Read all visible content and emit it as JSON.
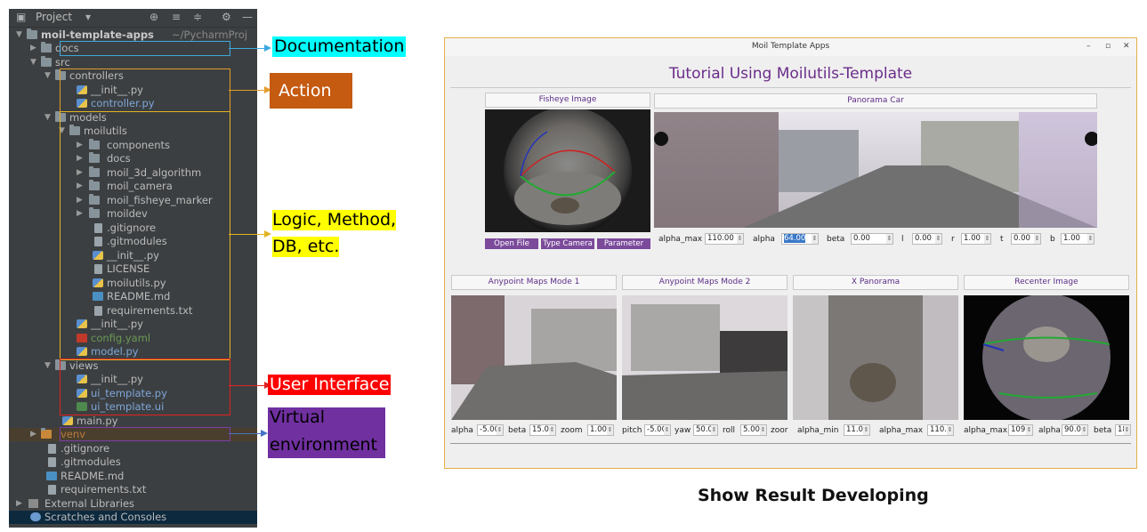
{
  "ide": {
    "title": "Project",
    "tree": [
      {
        "label": "moil-template-apps",
        "suffix": "~/PycharmProj",
        "kind": "folder",
        "style": "bold"
      },
      {
        "label": "docs",
        "kind": "folder"
      },
      {
        "label": "src",
        "kind": "folder"
      },
      {
        "label": "controllers",
        "kind": "folder"
      },
      {
        "label": "__init__.py",
        "kind": "py"
      },
      {
        "label": "controller.py",
        "kind": "py",
        "style": "blue"
      },
      {
        "label": "models",
        "kind": "folder"
      },
      {
        "label": "moilutils",
        "kind": "folder"
      },
      {
        "label": "components",
        "kind": "folder"
      },
      {
        "label": "docs",
        "kind": "folder"
      },
      {
        "label": "moil_3d_algorithm",
        "kind": "folder"
      },
      {
        "label": "moil_camera",
        "kind": "folder"
      },
      {
        "label": "moil_fisheye_marker",
        "kind": "folder"
      },
      {
        "label": "moildev",
        "kind": "folder"
      },
      {
        "label": ".gitignore",
        "kind": "txt"
      },
      {
        "label": ".gitmodules",
        "kind": "txt"
      },
      {
        "label": "__init__.py",
        "kind": "py"
      },
      {
        "label": "LICENSE",
        "kind": "txt"
      },
      {
        "label": "moilutils.py",
        "kind": "py"
      },
      {
        "label": "README.md",
        "kind": "md"
      },
      {
        "label": "requirements.txt",
        "kind": "txt"
      },
      {
        "label": "__init__.py",
        "kind": "py"
      },
      {
        "label": "config.yaml",
        "kind": "yaml",
        "style": "green"
      },
      {
        "label": "model.py",
        "kind": "py",
        "style": "blue"
      },
      {
        "label": "views",
        "kind": "folder"
      },
      {
        "label": "__init__.py",
        "kind": "py"
      },
      {
        "label": "ui_template.py",
        "kind": "py",
        "style": "blue"
      },
      {
        "label": "ui_template.ui",
        "kind": "ui",
        "style": "blue"
      },
      {
        "label": "main.py",
        "kind": "py"
      },
      {
        "label": "venv",
        "kind": "folder",
        "style": "orange"
      },
      {
        "label": ".gitignore",
        "kind": "txt"
      },
      {
        "label": ".gitmodules",
        "kind": "txt"
      },
      {
        "label": "README.md",
        "kind": "md"
      },
      {
        "label": "requirements.txt",
        "kind": "txt"
      },
      {
        "label": "External Libraries",
        "kind": "lib"
      },
      {
        "label": "Scratches and Consoles",
        "kind": "scratch"
      }
    ]
  },
  "annotations": {
    "documentation": {
      "text": "Documentation",
      "bg": "#00ffff",
      "fg": "#000000"
    },
    "action": {
      "text": "Action",
      "bg": "#c55a11",
      "fg": "#ffffff"
    },
    "logic_l1": "Logic, Method,",
    "logic_l2": "DB, etc.",
    "logic_bg": "#ffff00",
    "ui": {
      "text": "User Interface",
      "bg": "#ff0000",
      "fg": "#ffffff"
    },
    "venv_l1": "Virtual",
    "venv_l2": "environment",
    "venv_bg": "#7030a0",
    "venv_fg": "#000000"
  },
  "app": {
    "window_title": "Moil Template Apps",
    "heading": "Tutorial Using Moilutils-Template",
    "fisheye_title": "Fisheye Image",
    "panorama_title": "Panorama Car",
    "buttons": {
      "open_file": "Open File",
      "type_camera": "Type Camera",
      "parameter": "Parameter"
    },
    "panorama_controls": [
      {
        "label": "alpha_max",
        "value": "110.00"
      },
      {
        "label": "alpha",
        "value": "64.00"
      },
      {
        "label": "beta",
        "value": "0.00"
      },
      {
        "label": "l",
        "value": "0.00"
      },
      {
        "label": "r",
        "value": "1.00"
      },
      {
        "label": "t",
        "value": "0.00"
      },
      {
        "label": "b",
        "value": "1.00"
      }
    ],
    "bottom_panels": [
      {
        "title": "Anypoint Maps Mode 1"
      },
      {
        "title": "Anypoint Maps Mode 2"
      },
      {
        "title": "X Panorama"
      },
      {
        "title": "Recenter Image"
      }
    ],
    "mode1_controls": [
      {
        "label": "alpha",
        "value": "-5.00"
      },
      {
        "label": "beta",
        "value": "15.0"
      },
      {
        "label": "zoom",
        "value": "1.00"
      }
    ],
    "mode2_controls": [
      {
        "label": "pitch",
        "value": "-5.00"
      },
      {
        "label": "yaw",
        "value": "50.0"
      },
      {
        "label": "roll",
        "value": "5.00"
      },
      {
        "label": "zoor",
        "value": ""
      }
    ],
    "xpan_controls": [
      {
        "label": "alpha_min",
        "value": "11.0"
      },
      {
        "label": "alpha_max",
        "value": "110."
      }
    ],
    "recenter_controls": [
      {
        "label": "alpha_max",
        "value": "109."
      },
      {
        "label": "alpha",
        "value": "90.0"
      },
      {
        "label": "beta",
        "value": "180"
      }
    ]
  },
  "caption": "Show Result Developing"
}
